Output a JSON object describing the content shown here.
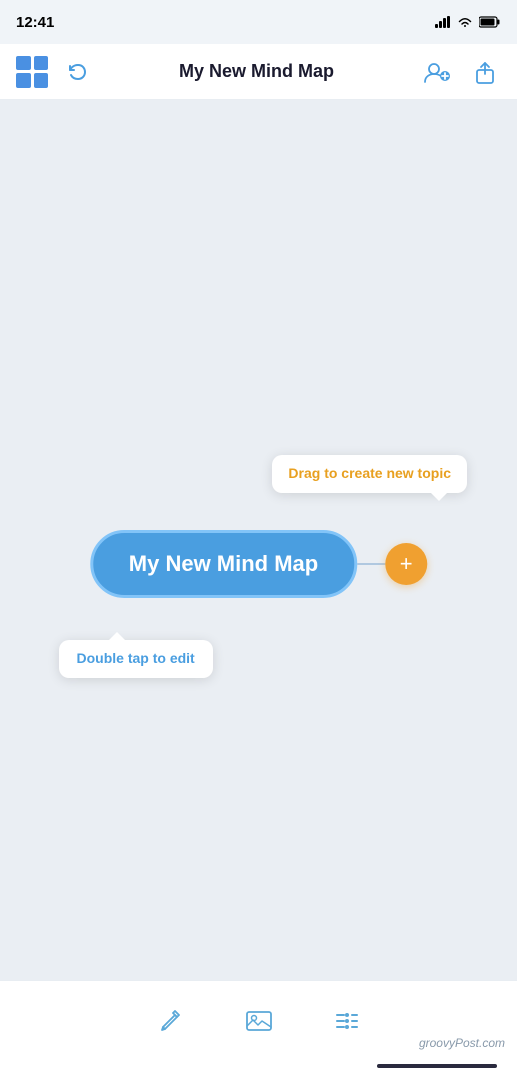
{
  "statusBar": {
    "time": "12:41",
    "icons": [
      "signal",
      "wifi",
      "battery"
    ]
  },
  "navBar": {
    "title": "My New Mind Map",
    "undoLabel": "undo",
    "addCollabLabel": "add-collaborator",
    "shareLabel": "share"
  },
  "mindMap": {
    "nodeLabel": "My New Mind Map",
    "tooltipDrag": "Drag to create new topic",
    "tooltipEdit": "Double tap to edit",
    "addButton": "+"
  },
  "toolbar": {
    "icons": [
      "pen-icon",
      "image-icon",
      "menu-icon"
    ]
  },
  "watermark": "groovyPost.com",
  "colors": {
    "accent": "#4a9ee0",
    "nodeBg": "#4a9ee0",
    "nodeBorder": "#82c4f8",
    "addBtn": "#f0a030",
    "dragTooltip": "#e8a020",
    "editTooltip": "#4a9ee0"
  }
}
